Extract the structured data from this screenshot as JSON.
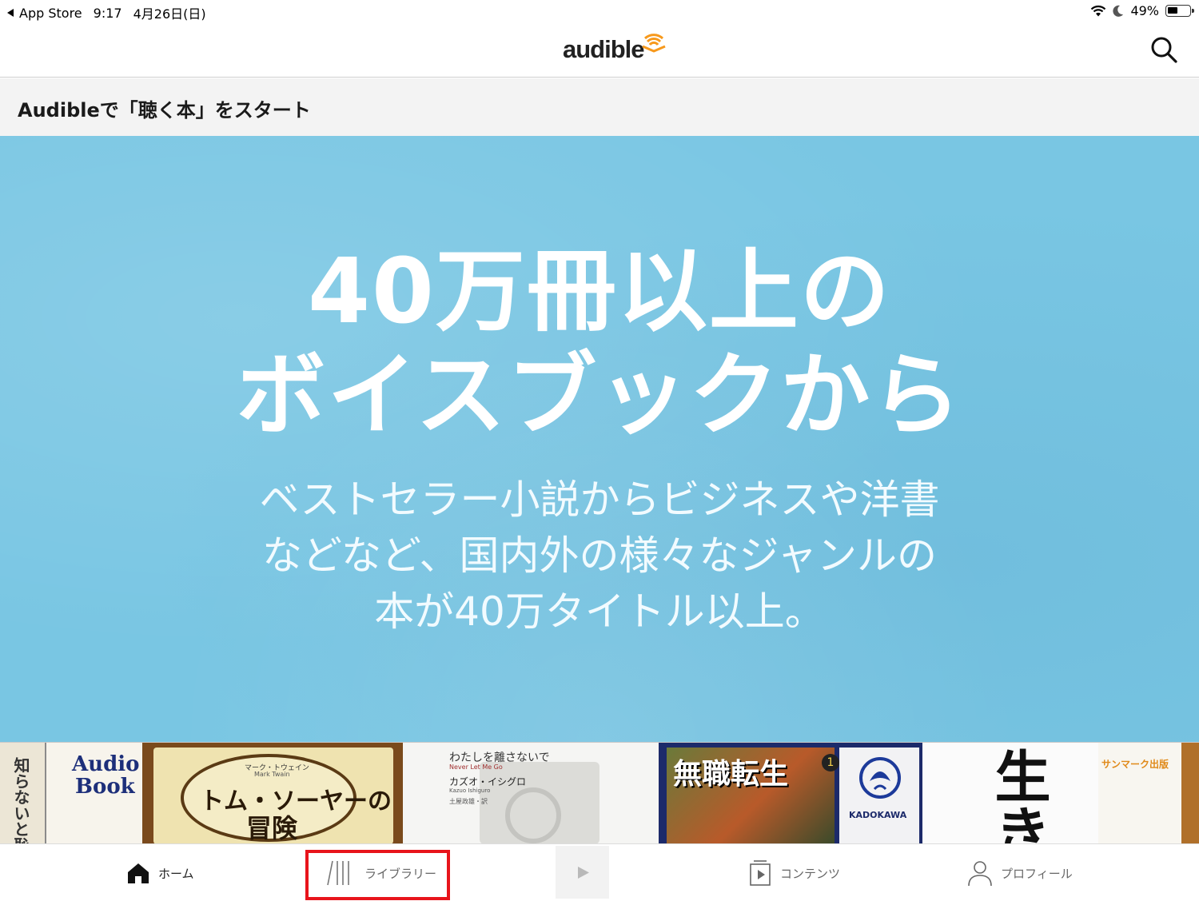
{
  "status_bar": {
    "back_app": "App Store",
    "time": "9:17",
    "date": "4月26日(日)",
    "battery": "49%"
  },
  "nav": {
    "logo": "audible",
    "search_icon": "search-icon"
  },
  "section": {
    "title": "Audibleで「聴く本」をスタート"
  },
  "hero": {
    "headline_line1": "40万冊以上の",
    "headline_line2": "ボイスブックから",
    "sub_line1": "ベストセラー小説からビジネスや洋書",
    "sub_line2": "などなど、国内外の様々なジャンルの",
    "sub_line3": "本が40万タイトル以上。",
    "background_color": "#79c6e3"
  },
  "books": {
    "book1_text": "知らないと恥",
    "book2_line1": "Audio",
    "book2_line2": "Book",
    "book3_author_jp": "マーク・トウェイン",
    "book3_author_en": "Mark Twain",
    "book3_title_line1": "トム・ソーヤーの",
    "book3_title_line2": "冒険",
    "book4_title": "わたしを離さないで",
    "book4_title_en": "Never Let Me Go",
    "book4_author": "カズオ・イシグロ",
    "book4_author_en": "Kazuo Ishiguro",
    "book4_translator": "土屋政雄・訳",
    "book5_title": "無職転生",
    "book5_volume": "1",
    "book5_publisher": "KADOKAWA",
    "book6_title": "生き方",
    "book7_publisher": "サンマーク出版"
  },
  "tab_bar": {
    "home": "ホーム",
    "library": "ライブラリー",
    "contents": "コンテンツ",
    "profile": "プロフィール"
  },
  "colors": {
    "accent_orange": "#f7991c",
    "highlight_red": "#e8141b"
  }
}
